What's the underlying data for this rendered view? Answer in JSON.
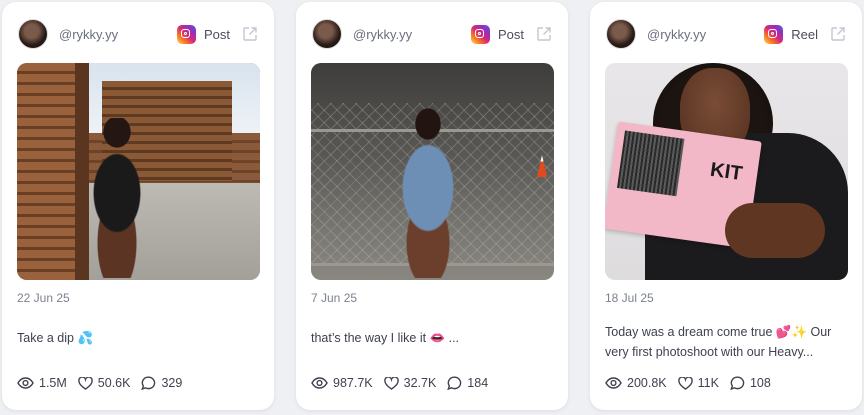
{
  "cards": [
    {
      "handle": "@rykky.yy",
      "post_type": "Post",
      "date": "22 Jun 25",
      "caption": "Take a dip 💦",
      "stats": {
        "views": "1.5M",
        "likes": "50.6K",
        "comments": "329"
      },
      "photo": "outdoor-pergola-photo"
    },
    {
      "handle": "@rykky.yy",
      "post_type": "Post",
      "date": "7 Jun 25",
      "caption": "that’s the way I like it 👄 ...",
      "stats": {
        "views": "987.7K",
        "likes": "32.7K",
        "comments": "184"
      },
      "photo": "parking-garage-fence-photo"
    },
    {
      "handle": "@rykky.yy",
      "post_type": "Reel",
      "date": "18 Jul 25",
      "caption": "Today was a dream come true 💕✨ Our very first photoshoot with our Heavy...",
      "stats": {
        "views": "200.8K",
        "likes": "11K",
        "comments": "108"
      },
      "photo": "lash-kit-product-photo",
      "kit_text": "KIT"
    }
  ],
  "icons": {
    "platform": "instagram-icon",
    "external": "external-link-icon",
    "views": "eye-icon",
    "likes": "heart-icon",
    "comments": "comment-icon"
  },
  "colors": {
    "background": "#eef0f4",
    "card": "#ffffff",
    "muted_text": "#7d8190",
    "body_text": "#3e4250"
  }
}
